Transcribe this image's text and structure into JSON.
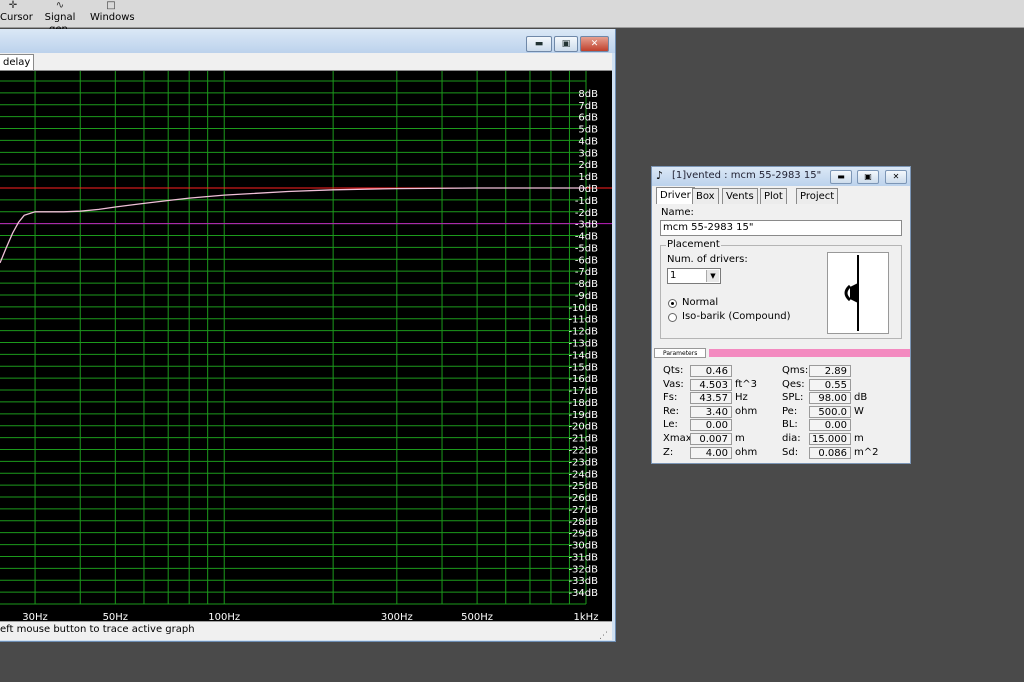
{
  "toolbar": {
    "items": [
      {
        "label": "Cursor",
        "icon": "cursor-icon"
      },
      {
        "label": "Signal gen.",
        "icon": "signal-gen-icon"
      },
      {
        "label": "Windows",
        "icon": "windows-icon"
      }
    ]
  },
  "graph_window": {
    "tab_label": "delay",
    "status_text": "eft mouse button to trace active graph"
  },
  "chart_data": {
    "type": "line",
    "x_scale": "log",
    "xlim": [
      24,
      1000
    ],
    "ylim": [
      -35,
      9
    ],
    "grid": true,
    "y_ticks": [
      "8dB",
      "7dB",
      "6dB",
      "5dB",
      "4dB",
      "3dB",
      "2dB",
      "1dB",
      "0dB",
      "-1dB",
      "-2dB",
      "-3dB",
      "-4dB",
      "-5dB",
      "-6dB",
      "-7dB",
      "-8dB",
      "-9dB",
      "-10dB",
      "-11dB",
      "-12dB",
      "-13dB",
      "-14dB",
      "-15dB",
      "-16dB",
      "-17dB",
      "-18dB",
      "-19dB",
      "-20dB",
      "-21dB",
      "-22dB",
      "-23dB",
      "-24dB",
      "-25dB",
      "-26dB",
      "-27dB",
      "-28dB",
      "-29dB",
      "-30dB",
      "-31dB",
      "-32dB",
      "-33dB",
      "-34dB"
    ],
    "x_tick_labels": [
      {
        "value": 30,
        "label": "30Hz"
      },
      {
        "value": 50,
        "label": "50Hz"
      },
      {
        "value": 100,
        "label": "100Hz"
      },
      {
        "value": 300,
        "label": "300Hz"
      },
      {
        "value": 500,
        "label": "500Hz"
      },
      {
        "value": 1000,
        "label": "1kHz"
      }
    ],
    "reference_lines": [
      {
        "y": 0,
        "color": "#ff2020"
      },
      {
        "y": -3,
        "color": "#c01fc0"
      }
    ],
    "series": [
      {
        "color": "#f0c0d8",
        "x": [
          24,
          25,
          26,
          27,
          28,
          30,
          33,
          36,
          40,
          45,
          50,
          60,
          70,
          80,
          100,
          150,
          200,
          300,
          500,
          700,
          1000
        ],
        "y": [
          -6.3,
          -5.0,
          -3.8,
          -2.9,
          -2.3,
          -2.0,
          -2.0,
          -2.0,
          -1.95,
          -1.8,
          -1.6,
          -1.3,
          -1.05,
          -0.85,
          -0.6,
          -0.3,
          -0.15,
          -0.05,
          0,
          0,
          0
        ]
      }
    ]
  },
  "dialog": {
    "title": "[1]vented : mcm 55-2983 15\"",
    "tabs": [
      "Driver",
      "Box",
      "Vents",
      "Plot",
      "Project"
    ],
    "name_label": "Name:",
    "name_value": "mcm 55-2983 15\"",
    "placement_legend": "Placement",
    "num_drivers_label": "Num. of drivers:",
    "num_drivers_value": "1",
    "radio_normal": "Normal",
    "radio_isobarik": "Iso-barik (Compound)",
    "params_tab": "Parameters",
    "params_left": [
      {
        "label": "Qts:",
        "value": "0.46",
        "unit": ""
      },
      {
        "label": "Vas:",
        "value": "4.503",
        "unit": "ft^3"
      },
      {
        "label": "Fs:",
        "value": "43.57",
        "unit": "Hz"
      },
      {
        "label": "Re:",
        "value": "3.40",
        "unit": "ohm"
      },
      {
        "label": "Le:",
        "value": "0.00",
        "unit": ""
      },
      {
        "label": "Xmax:",
        "value": "0.007",
        "unit": "m"
      },
      {
        "label": "Z:",
        "value": "4.00",
        "unit": "ohm"
      }
    ],
    "params_right": [
      {
        "label": "Qms:",
        "value": "2.89",
        "unit": ""
      },
      {
        "label": "Qes:",
        "value": "0.55",
        "unit": ""
      },
      {
        "label": "SPL:",
        "value": "98.00",
        "unit": "dB"
      },
      {
        "label": "Pe:",
        "value": "500.0",
        "unit": "W"
      },
      {
        "label": "BL:",
        "value": "0.00",
        "unit": ""
      },
      {
        "label": "dia:",
        "value": "15.000",
        "unit": "m"
      },
      {
        "label": "Sd:",
        "value": "0.086",
        "unit": "m^2"
      }
    ]
  }
}
